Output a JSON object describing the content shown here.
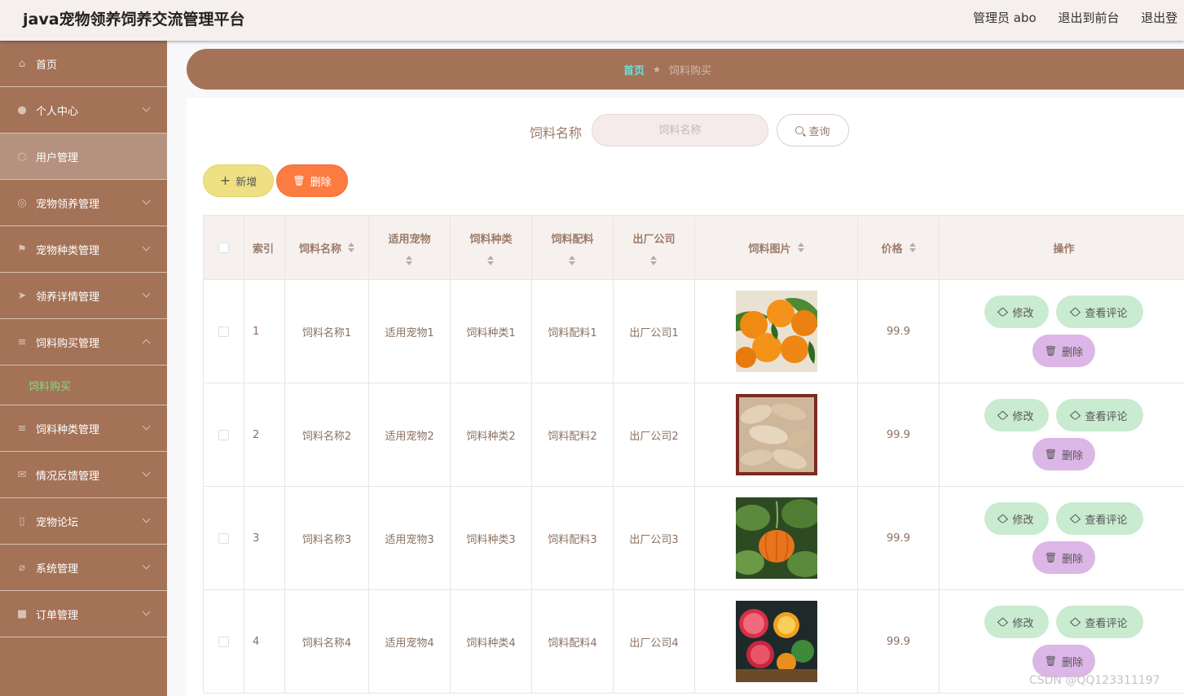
{
  "header": {
    "title": "java宠物领养饲养交流管理平台",
    "user": "管理员 abo",
    "to_front": "退出到前台",
    "logout": "退出登"
  },
  "sidebar": {
    "items": [
      {
        "label": "首页",
        "icon": "home-icon"
      },
      {
        "label": "个人中心",
        "icon": "user-icon"
      },
      {
        "label": "用户管理",
        "icon": "users-icon"
      },
      {
        "label": "宠物领养管理",
        "icon": "compass-icon"
      },
      {
        "label": "宠物种类管理",
        "icon": "flag-icon"
      },
      {
        "label": "领养详情管理",
        "icon": "send-icon"
      },
      {
        "label": "饲料购买管理",
        "icon": "menu-icon"
      },
      {
        "label": "饲料种类管理",
        "icon": "menu-icon"
      },
      {
        "label": "情况反馈管理",
        "icon": "message-icon"
      },
      {
        "label": "宠物论坛",
        "icon": "mic-icon"
      },
      {
        "label": "系统管理",
        "icon": "settings-icon"
      },
      {
        "label": "订单管理",
        "icon": "shop-icon"
      }
    ],
    "sub_item": "饲料购买"
  },
  "breadcrumb": {
    "home": "首页",
    "current": "饲料购买"
  },
  "search": {
    "label": "饲料名称",
    "placeholder": "饲料名称",
    "button": "查询"
  },
  "actions": {
    "add": "新增",
    "delete": "删除"
  },
  "table": {
    "columns": [
      "索引",
      "饲料名称",
      "适用宠物",
      "饲料种类",
      "饲料配料",
      "出厂公司",
      "饲料图片",
      "价格",
      "操作"
    ],
    "rows": [
      {
        "index": "1",
        "name": "饲料名称1",
        "pet": "适用宠物1",
        "type": "饲料种类1",
        "ingredient": "饲料配料1",
        "company": "出厂公司1",
        "image": "oranges",
        "price": "99.9"
      },
      {
        "index": "2",
        "name": "饲料名称2",
        "pet": "适用宠物2",
        "type": "饲料种类2",
        "ingredient": "饲料配料2",
        "company": "出厂公司2",
        "image": "ginger",
        "price": "99.9"
      },
      {
        "index": "3",
        "name": "饲料名称3",
        "pet": "适用宠物3",
        "type": "饲料种类3",
        "ingredient": "饲料配料3",
        "company": "出厂公司3",
        "image": "pumpkin",
        "price": "99.9"
      },
      {
        "index": "4",
        "name": "饲料名称4",
        "pet": "适用宠物4",
        "type": "饲料种类4",
        "ingredient": "饲料配料4",
        "company": "出厂公司4",
        "image": "citrus-slices",
        "price": "99.9"
      }
    ],
    "op_edit": "修改",
    "op_comment": "查看评论",
    "op_delete": "删除"
  },
  "watermark": "CSDN @QQ123311197"
}
